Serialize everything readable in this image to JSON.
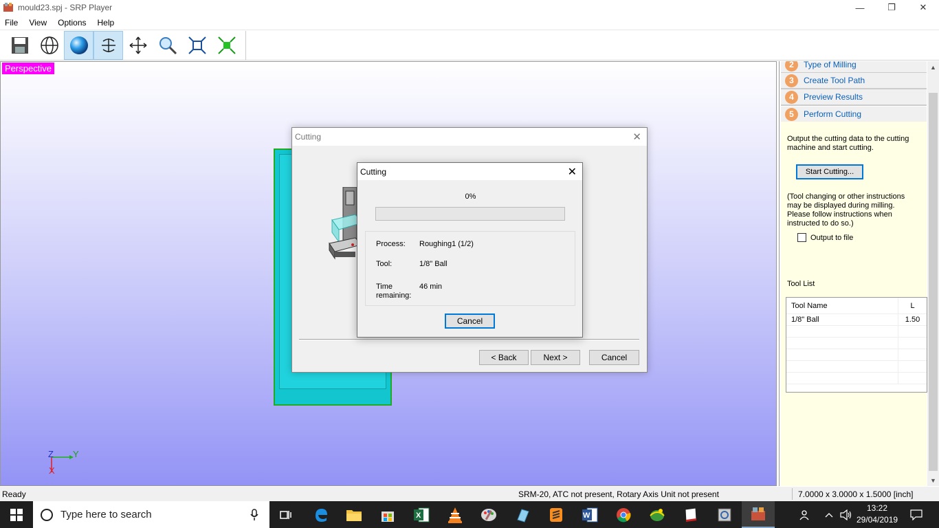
{
  "window": {
    "title": "mould23.spj - SRP Player",
    "controls": {
      "minimize": "—",
      "restore": "❐",
      "close": "✕"
    }
  },
  "menu": [
    "File",
    "View",
    "Options",
    "Help"
  ],
  "toolbar": {
    "icons": [
      "save-icon",
      "wireframe-globe-icon",
      "shaded-sphere-icon",
      "rotate-icon",
      "pan-icon",
      "zoom-icon",
      "fit-view-icon",
      "object-tools-icon"
    ]
  },
  "viewport": {
    "view_label": "Perspective",
    "axes": {
      "z": "Z",
      "y": "Y",
      "x": "X"
    }
  },
  "right_panel": {
    "steps": [
      {
        "number": "2",
        "label": "Type of Milling"
      },
      {
        "number": "3",
        "label": "Create Tool Path"
      },
      {
        "number": "4",
        "label": "Preview Results"
      },
      {
        "number": "5",
        "label": "Perform Cutting"
      }
    ],
    "description": "Output the cutting data to the cutting machine and start cutting.",
    "start_button": "Start Cutting...",
    "note": "(Tool changing or other instructions may be displayed during milling. Please follow instructions when instructed to do so.)",
    "output_to_file": "Output to file",
    "tool_list_label": "Tool List",
    "tool_table": {
      "headers": [
        "Tool Name",
        "L"
      ],
      "rows": [
        {
          "name": "1/8\" Ball",
          "l": "1.50"
        }
      ]
    }
  },
  "statusbar": {
    "left": "Ready",
    "machine": "SRM-20, ATC not present, Rotary Axis Unit not present",
    "dimensions": "7.0000 x 3.0000 x 1.5000 [inch]"
  },
  "outer_dialog": {
    "title": "Cutting",
    "back": "< Back",
    "next": "Next >",
    "cancel": "Cancel"
  },
  "inner_dialog": {
    "title": "Cutting",
    "percent_text": "0%",
    "progress_fraction": 0,
    "process_label": "Process:",
    "process_value": "Roughing1 (1/2)",
    "tool_label": "Tool:",
    "tool_value": "1/8\" Ball",
    "time_label_1": "Time",
    "time_label_2": "remaining:",
    "time_value": "46 min",
    "cancel": "Cancel"
  },
  "taskbar": {
    "search_placeholder": "Type here to search",
    "apps": [
      "task-view-icon",
      "edge-icon",
      "file-explorer-icon",
      "store-icon",
      "excel-icon",
      "vlc-icon",
      "paint-icon",
      "app-icon",
      "sublime-icon",
      "word-icon",
      "chrome-icon",
      "globe-app-icon",
      "book-app-icon",
      "settings-app-icon",
      "srp-player-icon"
    ],
    "time": "13:22",
    "date": "29/04/2019"
  },
  "colors": {
    "perspective_label_bg": "#ff00ff",
    "model_fill": "#12c5cf",
    "model_border": "#22aa22",
    "step_link": "#0a5fb8",
    "panel_bg": "#ffffe6",
    "focus_border": "#0078d7"
  }
}
